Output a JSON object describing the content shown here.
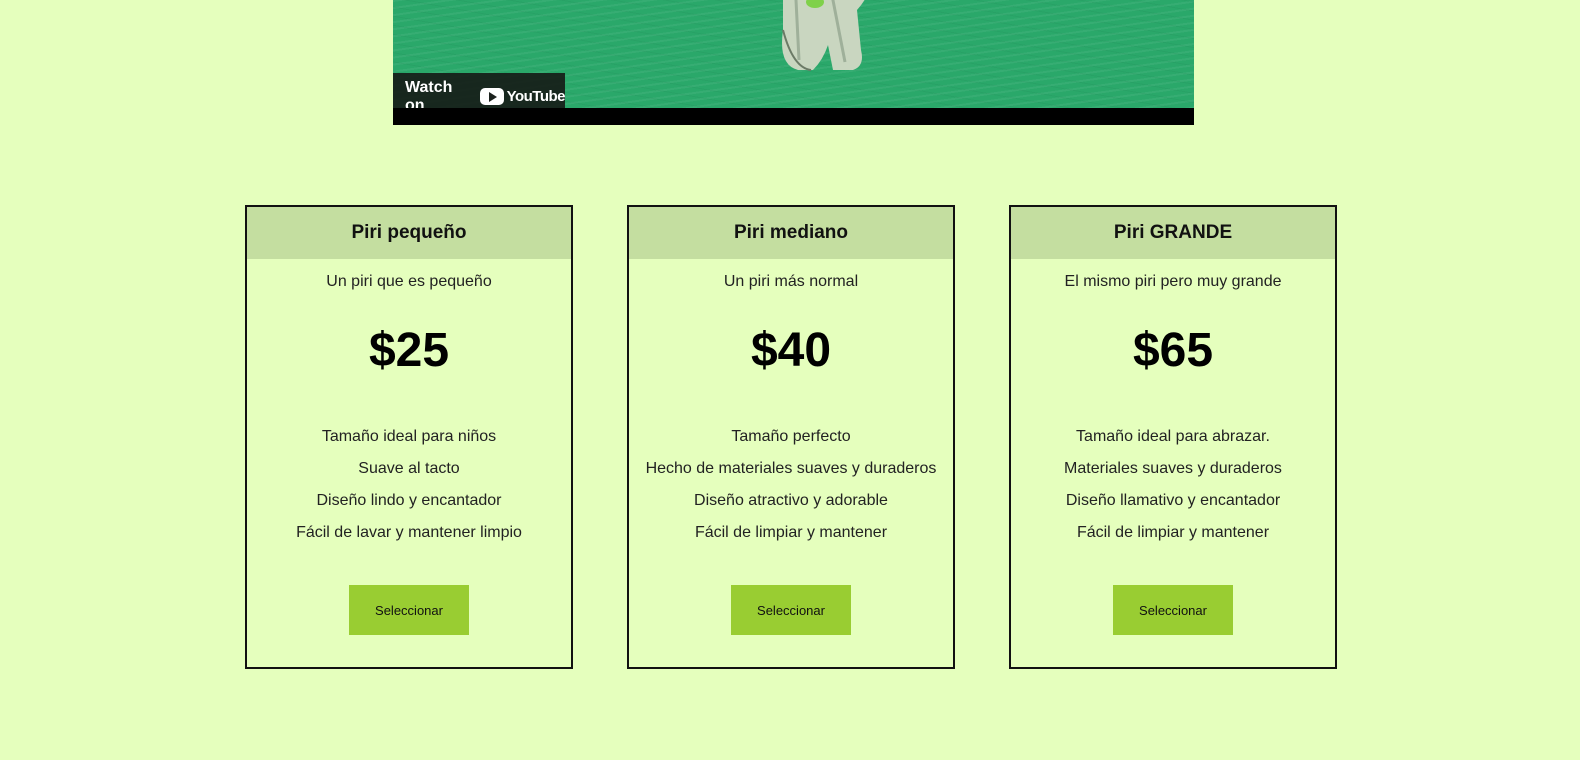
{
  "video": {
    "watch_label": "Watch on",
    "brand": "YouTube",
    "frame_color": "#2aa86a"
  },
  "plans": [
    {
      "title": "Piri pequeño",
      "description": "Un piri que es pequeño",
      "price": "$25",
      "features": [
        "Tamaño ideal para niños",
        "Suave al tacto",
        "Diseño lindo y encantador",
        "Fácil de lavar y mantener limpio"
      ],
      "button": "Seleccionar"
    },
    {
      "title": "Piri mediano",
      "description": "Un piri más normal",
      "price": "$40",
      "features": [
        "Tamaño perfecto",
        "Hecho de materiales suaves y duraderos",
        "Diseño atractivo y adorable",
        "Fácil de limpiar y mantener"
      ],
      "button": "Seleccionar"
    },
    {
      "title": "Piri GRANDE",
      "description": "El mismo piri pero muy grande",
      "price": "$65",
      "features": [
        "Tamaño ideal para abrazar.",
        "Materiales suaves y duraderos",
        "Diseño llamativo y encantador",
        "Fácil de limpiar y mantener"
      ],
      "button": "Seleccionar"
    }
  ],
  "colors": {
    "page_background": "#e5ffbd",
    "card_header": "#c4dea0",
    "button": "#99cd32"
  }
}
